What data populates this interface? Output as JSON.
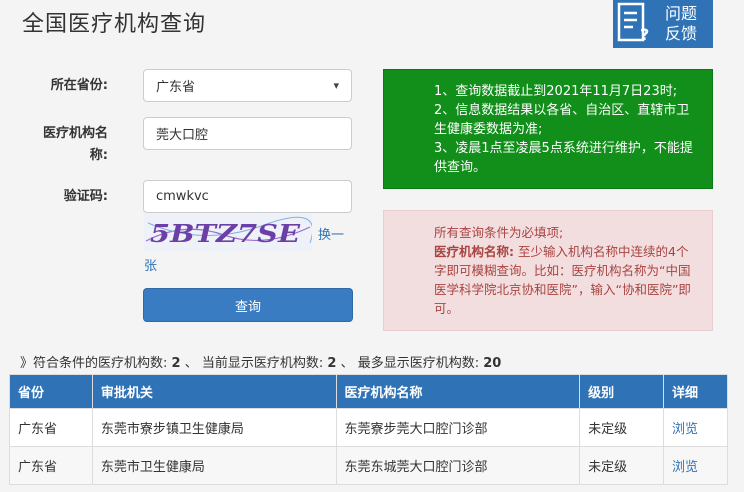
{
  "page": {
    "title": "全国医疗机构查询"
  },
  "feedback": {
    "line1": "问题",
    "line2": "反馈"
  },
  "form": {
    "province_label": "所在省份:",
    "province_value": "广东省",
    "name_label": "医疗机构名称:",
    "name_value": "莞大口腔",
    "code_label": "验证码:",
    "code_value": "cmwkvc",
    "captcha_text": "5BTZ7SE",
    "refresh_label_part1": "换一",
    "refresh_label_part2": "张",
    "submit_label": "查询"
  },
  "notice_green": {
    "line1": "1、查询数据截止到2021年11月7日23时;",
    "line2": "2、信息数据结果以各省、自治区、直辖市卫生健康委数据为准;",
    "line3": "3、凌晨1点至凌晨5点系统进行维护，不能提供查询。"
  },
  "notice_red": {
    "line1": "所有查询条件为必填项;",
    "term": "医疗机构名称:",
    "line2": "至少输入机构名称中连续的4个字即可模糊查询。比如：医疗机构名称为“中国医学科学院北京协和医院”，输入“协和医院”即可。"
  },
  "summary": {
    "prefix": "》符合条件的医疗机构数:",
    "matched": "2",
    "sep1": "、 当前显示医疗机构数:",
    "shown": "2",
    "sep2": "、 最多显示医疗机构数:",
    "max": "20"
  },
  "table": {
    "headers": [
      "省份",
      "审批机关",
      "医疗机构名称",
      "级别",
      "详细"
    ],
    "rows": [
      [
        "广东省",
        "东莞市寮步镇卫生健康局",
        "东莞寮步莞大口腔门诊部",
        "未定级",
        "浏览"
      ],
      [
        "广东省",
        "东莞市卫生健康局",
        "东莞东城莞大口腔门诊部",
        "未定级",
        "浏览"
      ]
    ]
  },
  "colors": {
    "primary": "#2f73b6",
    "notice_green": "#118f1a",
    "notice_red_bg": "#f2dede",
    "notice_red_text": "#a94442"
  },
  "icons": {
    "feedback": "feedback-document-icon",
    "select_caret": "chevron-down-icon"
  }
}
